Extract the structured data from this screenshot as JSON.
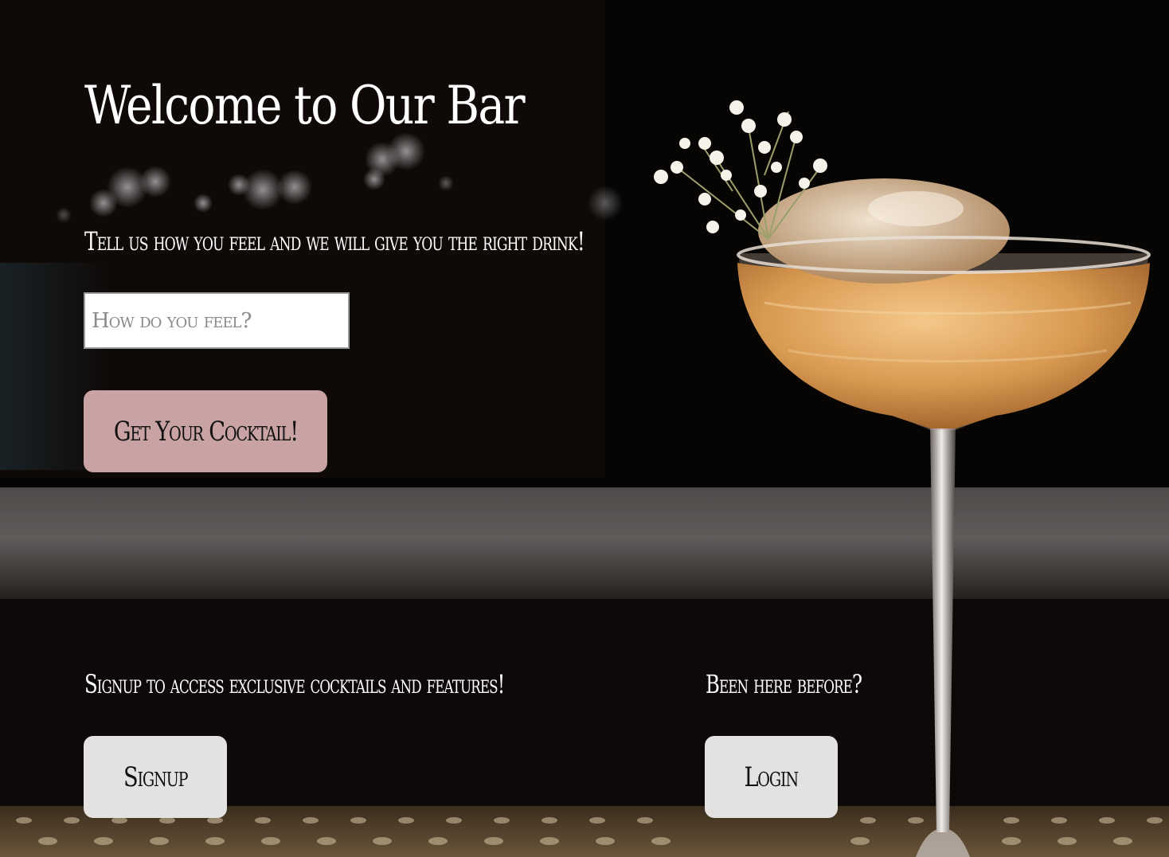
{
  "page": {
    "headline": "Welcome to Our Bar",
    "tagline": "Tell us how you feel and we will give you the right drink!"
  },
  "mood_form": {
    "input_placeholder": "How do you feel?",
    "input_value": "",
    "submit_label": "Get Your Cocktail!"
  },
  "signup": {
    "prompt": "Signup to access exclusive cocktails and features!",
    "button_label": "Signup"
  },
  "login": {
    "prompt": "Been here before?",
    "button_label": "Login"
  },
  "colors": {
    "cocktail_button": "#c9a3a4",
    "secondary_button": "#e4e1e1",
    "text": "#ffffff"
  }
}
